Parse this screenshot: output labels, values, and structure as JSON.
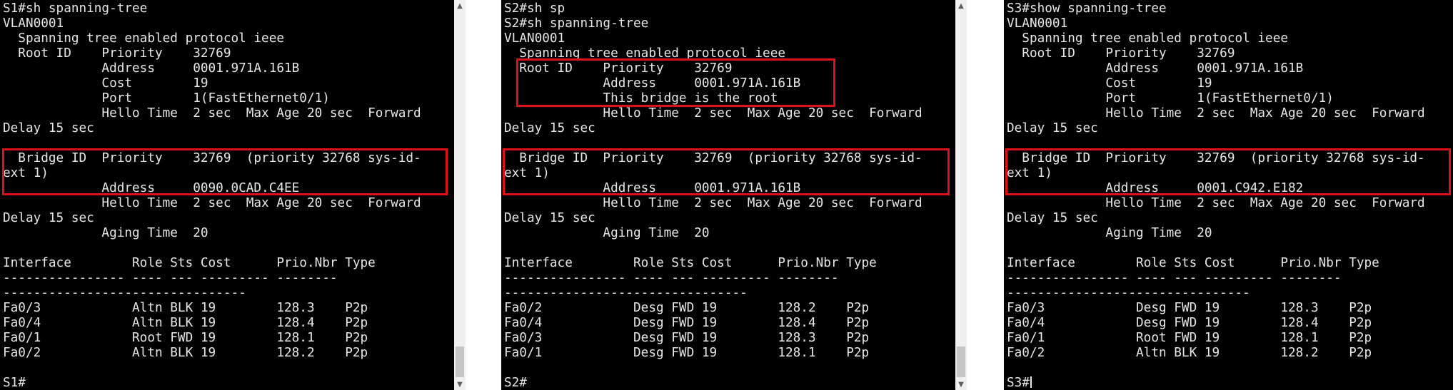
{
  "terminals": [
    {
      "id": "S1",
      "lines": [
        "S1#sh spanning-tree",
        "VLAN0001",
        "  Spanning tree enabled protocol ieee",
        "  Root ID    Priority    32769",
        "             Address     0001.971A.161B",
        "             Cost        19",
        "             Port        1(FastEthernet0/1)",
        "             Hello Time  2 sec  Max Age 20 sec  Forward",
        "Delay 15 sec",
        "",
        "  Bridge ID  Priority    32769  (priority 32768 sys-id-",
        "ext 1)",
        "             Address     0090.0CAD.C4EE",
        "             Hello Time  2 sec  Max Age 20 sec  Forward",
        "Delay 15 sec",
        "             Aging Time  20",
        "",
        "Interface        Role Sts Cost      Prio.Nbr Type",
        "---------------- ---- --- --------- --------",
        "--------------------------------",
        "Fa0/3            Altn BLK 19        128.3    P2p",
        "Fa0/4            Altn BLK 19        128.4    P2p",
        "Fa0/1            Root FWD 19        128.1    P2p",
        "Fa0/2            Altn BLK 19        128.2    P2p",
        "",
        "S1#"
      ]
    },
    {
      "id": "S2",
      "lines": [
        "S2#sh sp",
        "S2#sh spanning-tree",
        "VLAN0001",
        "  Spanning tree enabled protocol ieee",
        "  Root ID    Priority    32769",
        "             Address     0001.971A.161B",
        "             This bridge is the root",
        "             Hello Time  2 sec  Max Age 20 sec  Forward",
        "Delay 15 sec",
        "",
        "  Bridge ID  Priority    32769  (priority 32768 sys-id-",
        "ext 1)",
        "             Address     0001.971A.161B",
        "             Hello Time  2 sec  Max Age 20 sec  Forward",
        "Delay 15 sec",
        "             Aging Time  20",
        "",
        "Interface        Role Sts Cost      Prio.Nbr Type",
        "---------------- ---- --- --------- --------",
        "--------------------------------",
        "Fa0/2            Desg FWD 19        128.2    P2p",
        "Fa0/4            Desg FWD 19        128.4    P2p",
        "Fa0/3            Desg FWD 19        128.3    P2p",
        "Fa0/1            Desg FWD 19        128.1    P2p",
        "",
        "S2#"
      ]
    },
    {
      "id": "S3",
      "lines": [
        "S3#show spanning-tree",
        "VLAN0001",
        "  Spanning tree enabled protocol ieee",
        "  Root ID    Priority    32769",
        "             Address     0001.971A.161B",
        "             Cost        19",
        "             Port        1(FastEthernet0/1)",
        "             Hello Time  2 sec  Max Age 20 sec  Forward",
        "Delay 15 sec",
        "",
        "  Bridge ID  Priority    32769  (priority 32768 sys-id-",
        "ext 1)",
        "             Address     0001.C942.E182",
        "             Hello Time  2 sec  Max Age 20 sec  Forward",
        "Delay 15 sec",
        "             Aging Time  20",
        "",
        "Interface        Role Sts Cost      Prio.Nbr Type",
        "---------------- ---- --- --------- --------",
        "--------------------------------",
        "Fa0/3            Desg FWD 19        128.3    P2p",
        "Fa0/4            Desg FWD 19        128.4    P2p",
        "Fa0/1            Root FWD 19        128.1    P2p",
        "Fa0/2            Altn BLK 19        128.2    P2p",
        "",
        "S3#"
      ]
    }
  ],
  "colors": {
    "terminal_bg": "#000000",
    "terminal_fg": "#e6e6e6",
    "highlight": "#e0101a",
    "scrollbar_track": "#f0f0f0",
    "scrollbar_thumb": "#c6c6c6"
  },
  "scroll_icons": {
    "up": "chevron-up-icon",
    "down": "chevron-down-icon"
  }
}
